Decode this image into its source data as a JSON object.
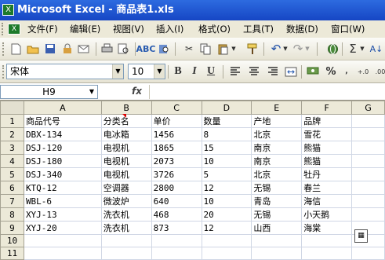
{
  "window": {
    "title": "Microsoft Excel - 商品表1.xls"
  },
  "menu": [
    "文件(F)",
    "编辑(E)",
    "视图(V)",
    "插入(I)",
    "格式(O)",
    "工具(T)",
    "数据(D)",
    "窗口(W)"
  ],
  "format_toolbar": {
    "font": "宋体",
    "size": "10",
    "bold": "B",
    "italic": "I",
    "underline": "U",
    "percent": "%"
  },
  "formula_bar": {
    "name_box": "H9",
    "fx": "fx",
    "content": ""
  },
  "sheet": {
    "columns": [
      "A",
      "B",
      "C",
      "D",
      "E",
      "F",
      "G"
    ],
    "rows": [
      {
        "n": "1",
        "cells": [
          "商品代号",
          "分类名",
          "单价",
          "数量",
          "产地",
          "品牌",
          ""
        ]
      },
      {
        "n": "2",
        "cells": [
          "DBX-134",
          "电冰箱",
          "1456",
          "8",
          "北京",
          "雪花",
          ""
        ]
      },
      {
        "n": "3",
        "cells": [
          "DSJ-120",
          "电视机",
          "1865",
          "15",
          "南京",
          "熊猫",
          ""
        ]
      },
      {
        "n": "4",
        "cells": [
          "DSJ-180",
          "电视机",
          "2073",
          "10",
          "南京",
          "熊猫",
          ""
        ]
      },
      {
        "n": "5",
        "cells": [
          "DSJ-340",
          "电视机",
          "3726",
          "5",
          "北京",
          "牡丹",
          ""
        ]
      },
      {
        "n": "6",
        "cells": [
          "KTQ-12",
          "空调器",
          "2800",
          "12",
          "无锡",
          "春兰",
          ""
        ]
      },
      {
        "n": "7",
        "cells": [
          "WBL-6",
          "微波炉",
          "640",
          "10",
          "青岛",
          "海信",
          ""
        ]
      },
      {
        "n": "8",
        "cells": [
          "XYJ-13",
          "洗衣机",
          "468",
          "20",
          "无锡",
          "小天鹅",
          ""
        ]
      },
      {
        "n": "9",
        "cells": [
          "XYJ-20",
          "洗衣机",
          "873",
          "12",
          "山西",
          "海棠",
          ""
        ]
      },
      {
        "n": "10",
        "cells": [
          "",
          "",
          "",
          "",
          "",
          "",
          ""
        ]
      },
      {
        "n": "11",
        "cells": [
          "",
          "",
          "",
          "",
          "",
          "",
          ""
        ]
      }
    ]
  }
}
